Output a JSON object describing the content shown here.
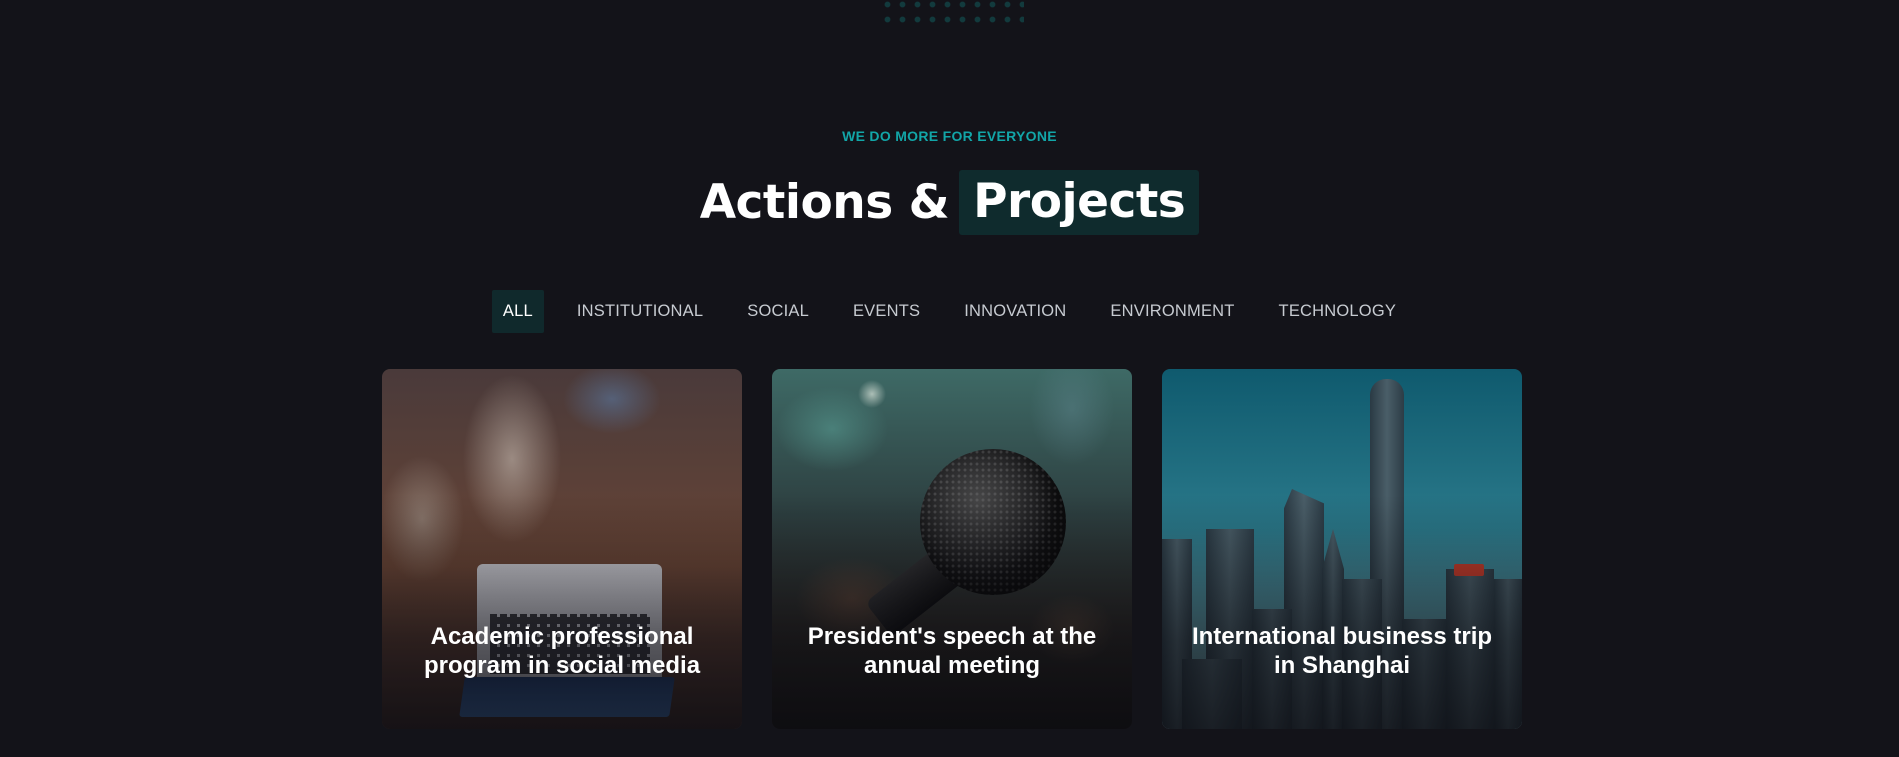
{
  "section": {
    "eyebrow": "WE DO MORE FOR EVERYONE",
    "title_plain": "Actions &",
    "title_highlight": "Projects"
  },
  "filters": [
    {
      "label": "ALL",
      "active": true
    },
    {
      "label": "INSTITUTIONAL",
      "active": false
    },
    {
      "label": "SOCIAL",
      "active": false
    },
    {
      "label": "EVENTS",
      "active": false
    },
    {
      "label": "INNOVATION",
      "active": false
    },
    {
      "label": "ENVIRONMENT",
      "active": false
    },
    {
      "label": "TECHNOLOGY",
      "active": false
    }
  ],
  "cards": [
    {
      "title": "Academic professional program in social media",
      "image": "students-laptop-photo"
    },
    {
      "title": "President's speech at the annual meeting",
      "image": "microphone-photo"
    },
    {
      "title": "International business trip in Shanghai",
      "image": "shanghai-skyline-photo"
    }
  ],
  "colors": {
    "background": "#131319",
    "accent": "#12a6a8",
    "highlight_bg": "#0f2b2d",
    "filter_text": "#c7cbd1"
  }
}
